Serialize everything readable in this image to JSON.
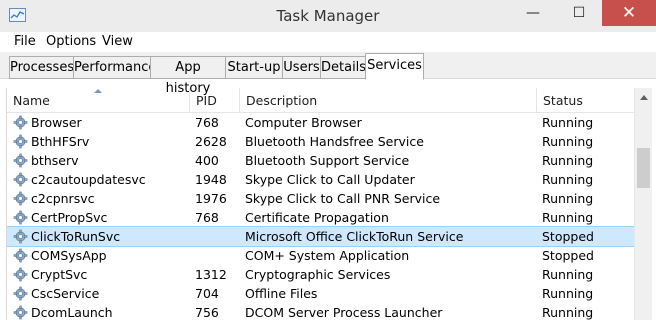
{
  "window": {
    "title": "Task Manager",
    "minimize_glyph": "—",
    "maximize_glyph": "☐",
    "close_glyph": "✕"
  },
  "menu": [
    "File",
    "Options",
    "View"
  ],
  "tabs": [
    "Processes",
    "Performance",
    "App history",
    "Start-up",
    "Users",
    "Details",
    "Services"
  ],
  "active_tab": "Services",
  "columns": {
    "name": "Name",
    "pid": "PID",
    "description": "Description",
    "status": "Status"
  },
  "rows": [
    {
      "name": "Browser",
      "pid": "768",
      "description": "Computer Browser",
      "status": "Running"
    },
    {
      "name": "BthHFSrv",
      "pid": "2628",
      "description": "Bluetooth Handsfree Service",
      "status": "Running"
    },
    {
      "name": "bthserv",
      "pid": "400",
      "description": "Bluetooth Support Service",
      "status": "Running"
    },
    {
      "name": "c2cautoupdatesvc",
      "pid": "1948",
      "description": "Skype Click to Call Updater",
      "status": "Running"
    },
    {
      "name": "c2cpnrsvc",
      "pid": "1976",
      "description": "Skype Click to Call PNR Service",
      "status": "Running"
    },
    {
      "name": "CertPropSvc",
      "pid": "768",
      "description": "Certificate Propagation",
      "status": "Running"
    },
    {
      "name": "ClickToRunSvc",
      "pid": "",
      "description": "Microsoft Office ClickToRun Service",
      "status": "Stopped"
    },
    {
      "name": "COMSysApp",
      "pid": "",
      "description": "COM+ System Application",
      "status": "Stopped"
    },
    {
      "name": "CryptSvc",
      "pid": "1312",
      "description": "Cryptographic Services",
      "status": "Running"
    },
    {
      "name": "CscService",
      "pid": "704",
      "description": "Offline Files",
      "status": "Running"
    },
    {
      "name": "DcomLaunch",
      "pid": "756",
      "description": "DCOM Server Process Launcher",
      "status": "Running"
    }
  ],
  "selected_row_name": "ClickToRunSvc",
  "row_icon": "service-gear-icon"
}
